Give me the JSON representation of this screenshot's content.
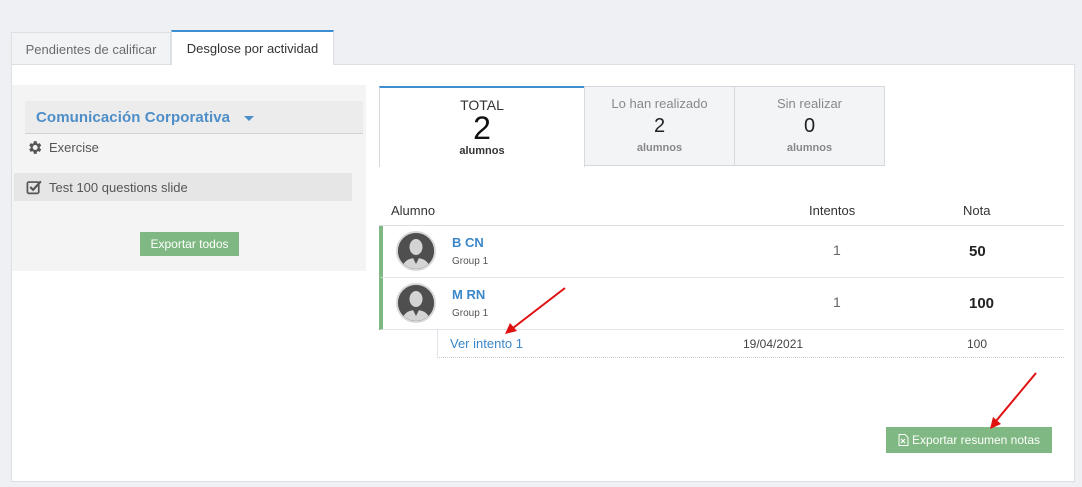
{
  "tabs": [
    {
      "label": "Pendientes de calificar",
      "active": false
    },
    {
      "label": "Desglose por actividad",
      "active": true
    }
  ],
  "sidebar": {
    "course": "Comunicación Corporativa",
    "activity_type": "Exercise",
    "activity": "Test 100 questions slide",
    "export_all_label": "Exportar todos"
  },
  "stats": {
    "total": {
      "label": "TOTAL",
      "value": "2",
      "unit": "alumnos"
    },
    "done": {
      "label": "Lo han realizado",
      "value": "2",
      "unit": "alumnos"
    },
    "pending": {
      "label": "Sin realizar",
      "value": "0",
      "unit": "alumnos"
    }
  },
  "table": {
    "headers": {
      "student": "Alumno",
      "attempts": "Intentos",
      "grade": "Nota"
    },
    "rows": [
      {
        "name": "B CN",
        "group": "Group 1",
        "attempts": "1",
        "grade": "50"
      },
      {
        "name": "M RN",
        "group": "Group 1",
        "attempts": "1",
        "grade": "100"
      }
    ],
    "attempt_detail": {
      "link": "Ver intento 1",
      "date": "19/04/2021",
      "grade": "100"
    }
  },
  "export_summary_label": "Exportar resumen notas",
  "colors": {
    "accent": "#3d8fd1",
    "link": "#3b87c9",
    "button": "#7fb882",
    "annotation": "#e01010"
  },
  "icons": {
    "course_caret": "caret-down-icon",
    "activity_type": "gear-icon",
    "activity": "checkbox-icon",
    "avatar": "user-silhouette-icon",
    "export": "file-export-icon"
  }
}
